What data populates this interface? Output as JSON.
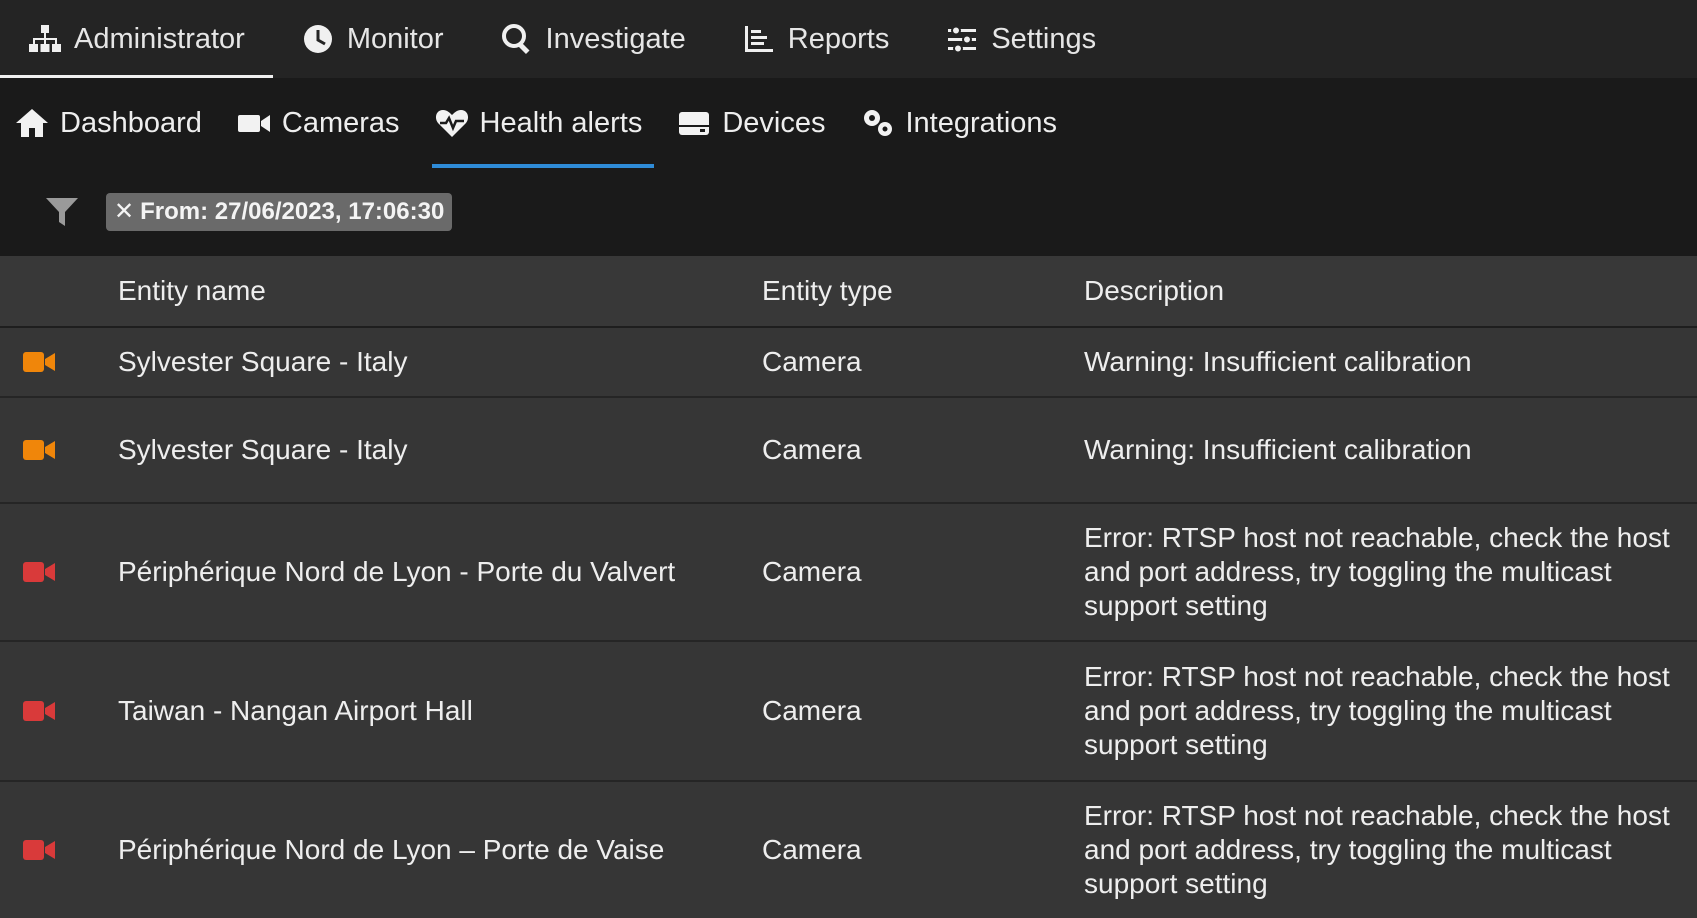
{
  "top_nav": [
    {
      "label": "Administrator",
      "icon": "sitemap-icon",
      "active": true
    },
    {
      "label": "Monitor",
      "icon": "clock-icon",
      "active": false
    },
    {
      "label": "Investigate",
      "icon": "search-icon",
      "active": false
    },
    {
      "label": "Reports",
      "icon": "chart-icon",
      "active": false
    },
    {
      "label": "Settings",
      "icon": "sliders-icon",
      "active": false
    }
  ],
  "sub_nav": [
    {
      "label": "Dashboard",
      "icon": "home-icon",
      "active": false
    },
    {
      "label": "Cameras",
      "icon": "video-camera-icon",
      "active": false
    },
    {
      "label": "Health alerts",
      "icon": "heart-pulse-icon",
      "active": true
    },
    {
      "label": "Devices",
      "icon": "server-icon",
      "active": false
    },
    {
      "label": "Integrations",
      "icon": "gears-icon",
      "active": false
    }
  ],
  "filter": {
    "chip_close": "✕",
    "chip_label": "From: 27/06/2023, 17:06:30"
  },
  "table": {
    "headers": {
      "name": "Entity name",
      "type": "Entity type",
      "description": "Description"
    },
    "rows": [
      {
        "severity": "warning",
        "color": "#f0860a",
        "name": "Sylvester Square - Italy",
        "type": "Camera",
        "description": "Warning: Insufficient calibration"
      },
      {
        "severity": "warning",
        "color": "#f0860a",
        "name": "Sylvester Square - Italy",
        "type": "Camera",
        "description": "Warning: Insufficient calibration"
      },
      {
        "severity": "error",
        "color": "#d93a3a",
        "name": "Périphérique Nord de Lyon - Porte du Valvert",
        "type": "Camera",
        "description": "Error: RTSP host not reachable, check the host and port address, try toggling the multicast support setting"
      },
      {
        "severity": "error",
        "color": "#d93a3a",
        "name": "Taiwan - Nangan Airport Hall",
        "type": "Camera",
        "description": "Error: RTSP host not reachable, check the host and port address, try toggling the multicast support setting"
      },
      {
        "severity": "error",
        "color": "#d93a3a",
        "name": "Périphérique Nord de Lyon – Porte de Vaise",
        "type": "Camera",
        "description": "Error: RTSP host not reachable, check the host and port address, try toggling the multicast support setting"
      }
    ]
  },
  "colors": {
    "warning": "#f0860a",
    "error": "#d93a3a",
    "active_tab": "#2f8cd8"
  }
}
